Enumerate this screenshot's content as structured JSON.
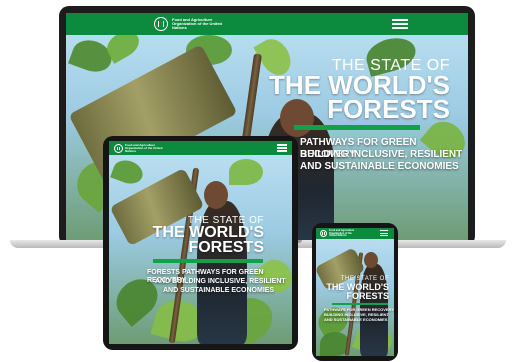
{
  "site": {
    "org_name": "Food and Agriculture Organization of the United Nations",
    "title_line1": "THE STATE OF",
    "title_line2": "THE WORLD'S",
    "title_line3": "FORESTS",
    "subtitle_line1": "PATHWAYS FOR GREEN RECOVERY",
    "subtitle_line2": "BUILDING INCLUSIVE, RESILIENT",
    "subtitle_line3": "AND SUSTAINABLE ECONOMIES",
    "tablet_subtitle_line1": "FORESTS PATHWAYS FOR GREEN RECOVERY",
    "tablet_subtitle_line2": "AND BUILDING INCLUSIVE, RESILIENT",
    "tablet_subtitle_line3": "AND SUSTAINABLE ECONOMIES",
    "phone_title_line2": "THE WORLD'S",
    "phone_title_line3": "FORESTS"
  },
  "colors": {
    "header_green": "#0c8a3e",
    "accent_green": "#14a04b",
    "text": "#ffffff",
    "device_frame": "#151515"
  },
  "icons": {
    "logo": "fao-logo-icon",
    "menu": "hamburger-menu-icon"
  }
}
